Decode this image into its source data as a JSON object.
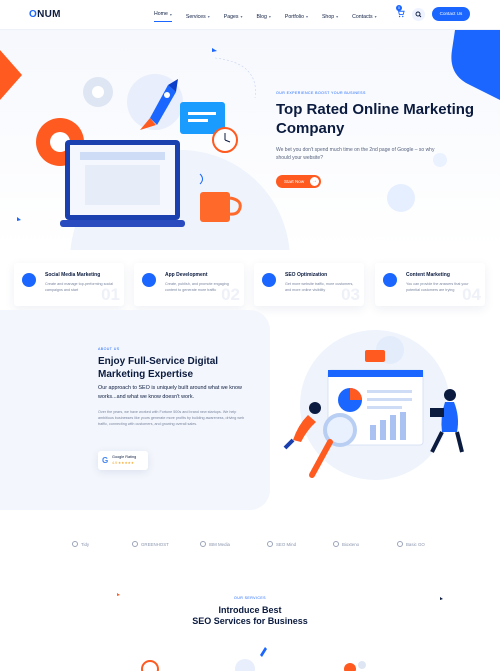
{
  "header": {
    "logo_prefix": "O",
    "logo_rest": "NUM",
    "nav": [
      {
        "label": "Home"
      },
      {
        "label": "Services"
      },
      {
        "label": "Pages"
      },
      {
        "label": "Blog"
      },
      {
        "label": "Portfolio"
      },
      {
        "label": "Shop"
      },
      {
        "label": "Contacts"
      }
    ],
    "cart_count": "0",
    "contact_label": "Contact Us"
  },
  "hero": {
    "eyebrow": "OUR EXPERIENCE BOOST YOUR BUSINESS",
    "title": "Top Rated Online Marketing Company",
    "text": "We bet you don't spend much time on the 2nd page of Google – so why should your website?",
    "button": "Start Now"
  },
  "cards": [
    {
      "title": "Social Media Marketing",
      "text": "Create and manage top-performing social campaigns and start",
      "num": "01"
    },
    {
      "title": "App Development",
      "text": "Create, publish, and promote engaging content to generate more traffic",
      "num": "02"
    },
    {
      "title": "SEO Optimization",
      "text": "Get more website traffic, more customers, and more online visibility",
      "num": "03"
    },
    {
      "title": "Content Marketing",
      "text": "You can provide the answers that your potential customers are trying",
      "num": "04"
    }
  ],
  "about": {
    "eyebrow": "ABOUT US",
    "title": "Enjoy Full-Service Digital Marketing Expertise",
    "lead": "Our approach to SEO is uniquely built around what we know works...and what we know doesn't work.",
    "text": "Over the years, we have worked with Fortune 500s and brand new startups. We help ambitious businesses like yours generate more profits by building awareness, driving web traffic, connecting with customers, and growing overall sales.",
    "rating_label": "Google Rating",
    "rating_value": "4.9 ★★★★★"
  },
  "brands": [
    "Tidy",
    "GREENHOST",
    "IBM Media",
    "SEO Mind",
    "Bioxteno",
    "Basic GO"
  ],
  "services": {
    "eyebrow": "OUR SERVICES",
    "title_line1": "Introduce Best",
    "title_line2": "SEO Services for Business"
  },
  "colors": {
    "primary": "#1a66ff",
    "accent": "#ff5a1f",
    "dark": "#0b1b3f"
  }
}
